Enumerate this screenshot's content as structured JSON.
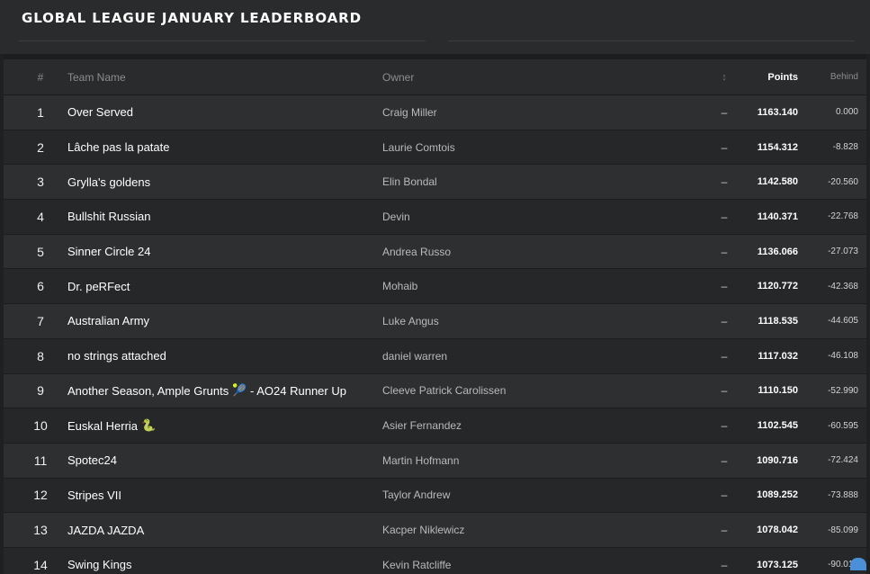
{
  "page": {
    "title": "GLOBAL LEAGUE JANUARY LEADERBOARD"
  },
  "columns": {
    "rank": "#",
    "team": "Team Name",
    "owner": "Owner",
    "movement": "↕",
    "points": "Points",
    "behind": "Behind"
  },
  "rows": [
    {
      "rank": "1",
      "team": "Over Served",
      "owner": "Craig Miller",
      "movement": "–",
      "points": "1163.140",
      "behind": "0.000"
    },
    {
      "rank": "2",
      "team": "Lâche pas la patate",
      "owner": "Laurie Comtois",
      "movement": "–",
      "points": "1154.312",
      "behind": "-8.828"
    },
    {
      "rank": "3",
      "team": "Grylla's goldens",
      "owner": "Elin Bondal",
      "movement": "–",
      "points": "1142.580",
      "behind": "-20.560"
    },
    {
      "rank": "4",
      "team": "Bullshit Russian",
      "owner": "Devin",
      "movement": "–",
      "points": "1140.371",
      "behind": "-22.768"
    },
    {
      "rank": "5",
      "team": "Sinner Circle 24",
      "owner": "Andrea Russo",
      "movement": "–",
      "points": "1136.066",
      "behind": "-27.073"
    },
    {
      "rank": "6",
      "team": "Dr. peRFect",
      "owner": "Mohaib",
      "movement": "–",
      "points": "1120.772",
      "behind": "-42.368"
    },
    {
      "rank": "7",
      "team": "Australian Army",
      "owner": "Luke Angus",
      "movement": "–",
      "points": "1118.535",
      "behind": "-44.605"
    },
    {
      "rank": "8",
      "team": "no strings attached",
      "owner": "daniel warren",
      "movement": "–",
      "points": "1117.032",
      "behind": "-46.108"
    },
    {
      "rank": "9",
      "team": "Another Season, Ample Grunts",
      "emoji": "🎾",
      "team_suffix": " - AO24 Runner Up",
      "owner": "Cleeve Patrick Carolissen",
      "movement": "–",
      "points": "1110.150",
      "behind": "-52.990"
    },
    {
      "rank": "10",
      "team": "Euskal Herria",
      "emoji": "🐍",
      "owner": "Asier Fernandez",
      "movement": "–",
      "points": "1102.545",
      "behind": "-60.595"
    },
    {
      "rank": "11",
      "team": "Spotec24",
      "owner": "Martin Hofmann",
      "movement": "–",
      "points": "1090.716",
      "behind": "-72.424"
    },
    {
      "rank": "12",
      "team": "Stripes VII",
      "owner": "Taylor Andrew",
      "movement": "–",
      "points": "1089.252",
      "behind": "-73.888"
    },
    {
      "rank": "13",
      "team": "JAZDA JAZDA",
      "owner": "Kacper Niklewicz",
      "movement": "–",
      "points": "1078.042",
      "behind": "-85.099"
    },
    {
      "rank": "14",
      "team": "Swing Kings",
      "owner": "Kevin Ratcliffe",
      "movement": "–",
      "points": "1073.125",
      "behind": "-90.016"
    }
  ],
  "colors": {
    "background": "#1f2022",
    "row_odd": "#2e2f31",
    "row_even": "#262729",
    "header": "#2a2b2d",
    "text_primary": "#ffffff",
    "text_muted": "#8c8d90"
  }
}
